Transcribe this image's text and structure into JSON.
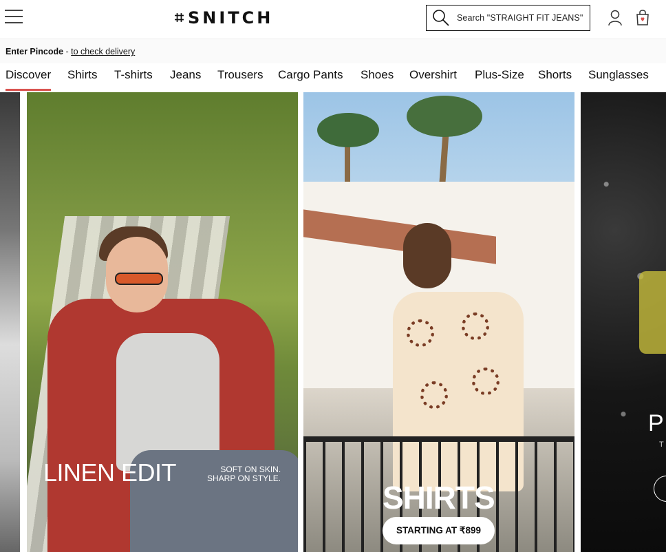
{
  "header": {
    "logo_mark": "⌗",
    "logo_text": "SNITCH",
    "search_placeholder": "Search \"STRAIGHT FIT JEANS\"",
    "icons": [
      "menu-icon",
      "search-icon",
      "user-icon",
      "shopping-bag-icon"
    ]
  },
  "pincode": {
    "label": "Enter Pincode",
    "separator": " - ",
    "link": "to check delivery"
  },
  "categories": [
    {
      "label": "Discover",
      "active": true
    },
    {
      "label": "Shirts"
    },
    {
      "label": "T-shirts"
    },
    {
      "label": "Jeans"
    },
    {
      "label": "Trousers"
    },
    {
      "label": "Cargo Pants"
    },
    {
      "label": "Shoes"
    },
    {
      "label": "Overshirt"
    },
    {
      "label": "Plus-Size"
    },
    {
      "label": "Shorts"
    },
    {
      "label": "Sunglasses"
    }
  ],
  "banners": {
    "linen": {
      "title": "LINEN EDIT",
      "subtitle_line1": "SOFT ON SKIN.",
      "subtitle_line2": "SHARP ON STYLE."
    },
    "shirts": {
      "title": "SHIRTS",
      "cta": "STARTING AT ₹899"
    },
    "partial": {
      "title": "P",
      "subtitle": "T"
    }
  },
  "colors": {
    "accent": "#d9534f"
  }
}
